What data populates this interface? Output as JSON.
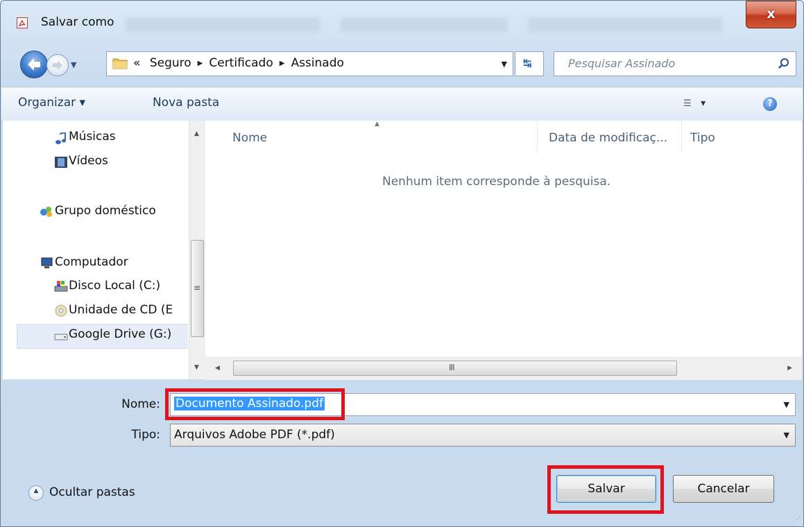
{
  "window": {
    "title": "Salvar como",
    "close_label": "x"
  },
  "nav": {
    "breadcrumb_prefix": "«",
    "breadcrumb": [
      "Seguro",
      "Certificado",
      "Assinado"
    ],
    "search_placeholder": "Pesquisar Assinado"
  },
  "toolbar": {
    "organize_label": "Organizar ▾",
    "new_folder_label": "Nova pasta",
    "view_label": "▾",
    "help_label": "?"
  },
  "sidebar": {
    "items": [
      {
        "label": "Músicas",
        "icon": "music-icon"
      },
      {
        "label": "Vídeos",
        "icon": "video-icon"
      },
      {
        "label": "Grupo doméstico",
        "icon": "homegroup-icon"
      },
      {
        "label": "Computador",
        "icon": "computer-icon"
      },
      {
        "label": "Disco Local (C:)",
        "icon": "local-disk-icon"
      },
      {
        "label": "Unidade de CD (E",
        "icon": "cd-drive-icon"
      },
      {
        "label": "Google Drive (G:)",
        "icon": "drive-icon",
        "selected": true
      }
    ]
  },
  "files": {
    "columns": [
      "Nome",
      "Data de modificaç...",
      "Tipo"
    ],
    "empty_message": "Nenhum item corresponde à pesquisa."
  },
  "form": {
    "name_label": "Nome:",
    "name_value": "Documento Assinado.pdf",
    "type_label": "Tipo:",
    "type_value": "Arquivos Adobe PDF (*.pdf)"
  },
  "footer": {
    "hide_folders_label": "Ocultar pastas",
    "save_label": "Salvar",
    "cancel_label": "Cancelar"
  },
  "colors": {
    "highlight": "#e0141c",
    "selection": "#3399ff"
  }
}
